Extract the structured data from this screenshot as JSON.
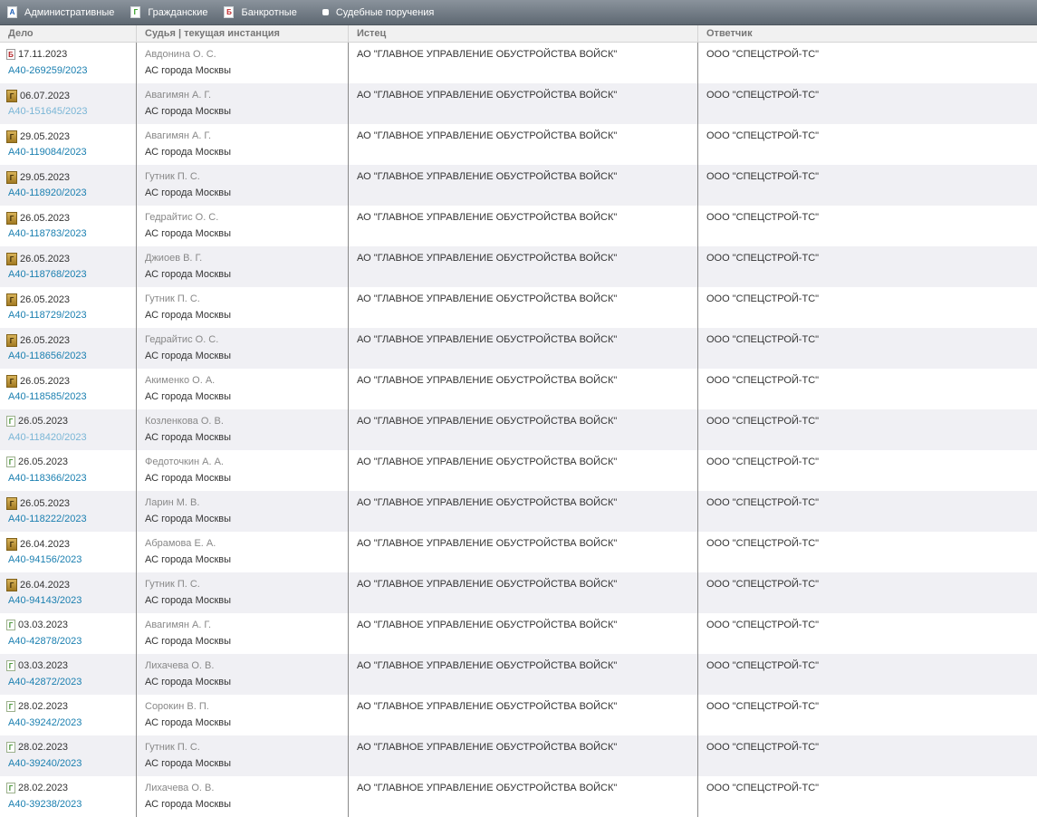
{
  "toolbar": {
    "items": [
      {
        "label": "Административные",
        "icon": "А"
      },
      {
        "label": "Гражданские",
        "icon": "Г"
      },
      {
        "label": "Банкротные",
        "icon": "Б"
      },
      {
        "label": "Судебные поручения"
      }
    ]
  },
  "table": {
    "headers": [
      "Дело",
      "Судья | текущая инстанция",
      "Истец",
      "Ответчик"
    ],
    "rows": [
      {
        "type": "bank",
        "icon": "Б",
        "date": "17.11.2023",
        "case": "А40-269259/2023",
        "judge": "Авдонина О. С.",
        "court": "АС города Москвы",
        "plaintiff": "АО \"ГЛАВНОЕ УПРАВЛЕНИЕ ОБУСТРОЙСТВА ВОЙСК\"",
        "defendant": "ООО \"СПЕЦСТРОЙ-ТС\""
      },
      {
        "type": "civ-gold",
        "icon": "Г",
        "date": "06.07.2023",
        "case": "А40-151645/2023",
        "judge": "Авагимян А. Г.",
        "court": "АС города Москвы",
        "plaintiff": "АО \"ГЛАВНОЕ УПРАВЛЕНИЕ ОБУСТРОЙСТВА ВОЙСК\"",
        "defendant": "ООО \"СПЕЦСТРОЙ-ТС\"",
        "visited": true
      },
      {
        "type": "civ-gold",
        "icon": "Г",
        "date": "29.05.2023",
        "case": "А40-119084/2023",
        "judge": "Авагимян А. Г.",
        "court": "АС города Москвы",
        "plaintiff": "АО \"ГЛАВНОЕ УПРАВЛЕНИЕ ОБУСТРОЙСТВА ВОЙСК\"",
        "defendant": "ООО \"СПЕЦСТРОЙ-ТС\""
      },
      {
        "type": "civ-gold",
        "icon": "Г",
        "date": "29.05.2023",
        "case": "А40-118920/2023",
        "judge": "Гутник П. С.",
        "court": "АС города Москвы",
        "plaintiff": "АО \"ГЛАВНОЕ УПРАВЛЕНИЕ ОБУСТРОЙСТВА ВОЙСК\"",
        "defendant": "ООО \"СПЕЦСТРОЙ-ТС\""
      },
      {
        "type": "civ-gold",
        "icon": "Г",
        "date": "26.05.2023",
        "case": "А40-118783/2023",
        "judge": "Гедрайтис О. С.",
        "court": "АС города Москвы",
        "plaintiff": "АО \"ГЛАВНОЕ УПРАВЛЕНИЕ ОБУСТРОЙСТВА ВОЙСК\"",
        "defendant": "ООО \"СПЕЦСТРОЙ-ТС\""
      },
      {
        "type": "civ-gold",
        "icon": "Г",
        "date": "26.05.2023",
        "case": "А40-118768/2023",
        "judge": "Джиоев В. Г.",
        "court": "АС города Москвы",
        "plaintiff": "АО \"ГЛАВНОЕ УПРАВЛЕНИЕ ОБУСТРОЙСТВА ВОЙСК\"",
        "defendant": "ООО \"СПЕЦСТРОЙ-ТС\""
      },
      {
        "type": "civ-gold",
        "icon": "Г",
        "date": "26.05.2023",
        "case": "А40-118729/2023",
        "judge": "Гутник П. С.",
        "court": "АС города Москвы",
        "plaintiff": "АО \"ГЛАВНОЕ УПРАВЛЕНИЕ ОБУСТРОЙСТВА ВОЙСК\"",
        "defendant": "ООО \"СПЕЦСТРОЙ-ТС\""
      },
      {
        "type": "civ-gold",
        "icon": "Г",
        "date": "26.05.2023",
        "case": "А40-118656/2023",
        "judge": "Гедрайтис О. С.",
        "court": "АС города Москвы",
        "plaintiff": "АО \"ГЛАВНОЕ УПРАВЛЕНИЕ ОБУСТРОЙСТВА ВОЙСК\"",
        "defendant": "ООО \"СПЕЦСТРОЙ-ТС\""
      },
      {
        "type": "civ-gold",
        "icon": "Г",
        "date": "26.05.2023",
        "case": "А40-118585/2023",
        "judge": "Акименко О. А.",
        "court": "АС города Москвы",
        "plaintiff": "АО \"ГЛАВНОЕ УПРАВЛЕНИЕ ОБУСТРОЙСТВА ВОЙСК\"",
        "defendant": "ООО \"СПЕЦСТРОЙ-ТС\""
      },
      {
        "type": "civ-paper",
        "icon": "Г",
        "date": "26.05.2023",
        "case": "А40-118420/2023",
        "judge": "Козленкова О. В.",
        "court": "АС города Москвы",
        "plaintiff": "АО \"ГЛАВНОЕ УПРАВЛЕНИЕ ОБУСТРОЙСТВА ВОЙСК\"",
        "defendant": "ООО \"СПЕЦСТРОЙ-ТС\"",
        "visited": true
      },
      {
        "type": "civ-paper",
        "icon": "Г",
        "date": "26.05.2023",
        "case": "А40-118366/2023",
        "judge": "Федоточкин А. А.",
        "court": "АС города Москвы",
        "plaintiff": "АО \"ГЛАВНОЕ УПРАВЛЕНИЕ ОБУСТРОЙСТВА ВОЙСК\"",
        "defendant": "ООО \"СПЕЦСТРОЙ-ТС\""
      },
      {
        "type": "civ-gold",
        "icon": "Г",
        "date": "26.05.2023",
        "case": "А40-118222/2023",
        "judge": "Ларин М. В.",
        "court": "АС города Москвы",
        "plaintiff": "АО \"ГЛАВНОЕ УПРАВЛЕНИЕ ОБУСТРОЙСТВА ВОЙСК\"",
        "defendant": "ООО \"СПЕЦСТРОЙ-ТС\""
      },
      {
        "type": "civ-gold",
        "icon": "Г",
        "date": "26.04.2023",
        "case": "А40-94156/2023",
        "judge": "Абрамова Е. А.",
        "court": "АС города Москвы",
        "plaintiff": "АО \"ГЛАВНОЕ УПРАВЛЕНИЕ ОБУСТРОЙСТВА ВОЙСК\"",
        "defendant": "ООО \"СПЕЦСТРОЙ-ТС\""
      },
      {
        "type": "civ-gold",
        "icon": "Г",
        "date": "26.04.2023",
        "case": "А40-94143/2023",
        "judge": "Гутник П. С.",
        "court": "АС города Москвы",
        "plaintiff": "АО \"ГЛАВНОЕ УПРАВЛЕНИЕ ОБУСТРОЙСТВА ВОЙСК\"",
        "defendant": "ООО \"СПЕЦСТРОЙ-ТС\""
      },
      {
        "type": "civ-paper",
        "icon": "Г",
        "date": "03.03.2023",
        "case": "А40-42878/2023",
        "judge": "Авагимян А. Г.",
        "court": "АС города Москвы",
        "plaintiff": "АО \"ГЛАВНОЕ УПРАВЛЕНИЕ ОБУСТРОЙСТВА ВОЙСК\"",
        "defendant": "ООО \"СПЕЦСТРОЙ-ТС\""
      },
      {
        "type": "civ-paper",
        "icon": "Г",
        "date": "03.03.2023",
        "case": "А40-42872/2023",
        "judge": "Лихачева О. В.",
        "court": "АС города Москвы",
        "plaintiff": "АО \"ГЛАВНОЕ УПРАВЛЕНИЕ ОБУСТРОЙСТВА ВОЙСК\"",
        "defendant": "ООО \"СПЕЦСТРОЙ-ТС\""
      },
      {
        "type": "civ-paper",
        "icon": "Г",
        "date": "28.02.2023",
        "case": "А40-39242/2023",
        "judge": "Сорокин В. П.",
        "court": "АС города Москвы",
        "plaintiff": "АО \"ГЛАВНОЕ УПРАВЛЕНИЕ ОБУСТРОЙСТВА ВОЙСК\"",
        "defendant": "ООО \"СПЕЦСТРОЙ-ТС\""
      },
      {
        "type": "civ-paper",
        "icon": "Г",
        "date": "28.02.2023",
        "case": "А40-39240/2023",
        "judge": "Гутник П. С.",
        "court": "АС города Москвы",
        "plaintiff": "АО \"ГЛАВНОЕ УПРАВЛЕНИЕ ОБУСТРОЙСТВА ВОЙСК\"",
        "defendant": "ООО \"СПЕЦСТРОЙ-ТС\""
      },
      {
        "type": "civ-paper",
        "icon": "Г",
        "date": "28.02.2023",
        "case": "А40-39238/2023",
        "judge": "Лихачева О. В.",
        "court": "АС города Москвы",
        "plaintiff": "АО \"ГЛАВНОЕ УПРАВЛЕНИЕ ОБУСТРОЙСТВА ВОЙСК\"",
        "defendant": "ООО \"СПЕЦСТРОЙ-ТС\""
      }
    ]
  }
}
